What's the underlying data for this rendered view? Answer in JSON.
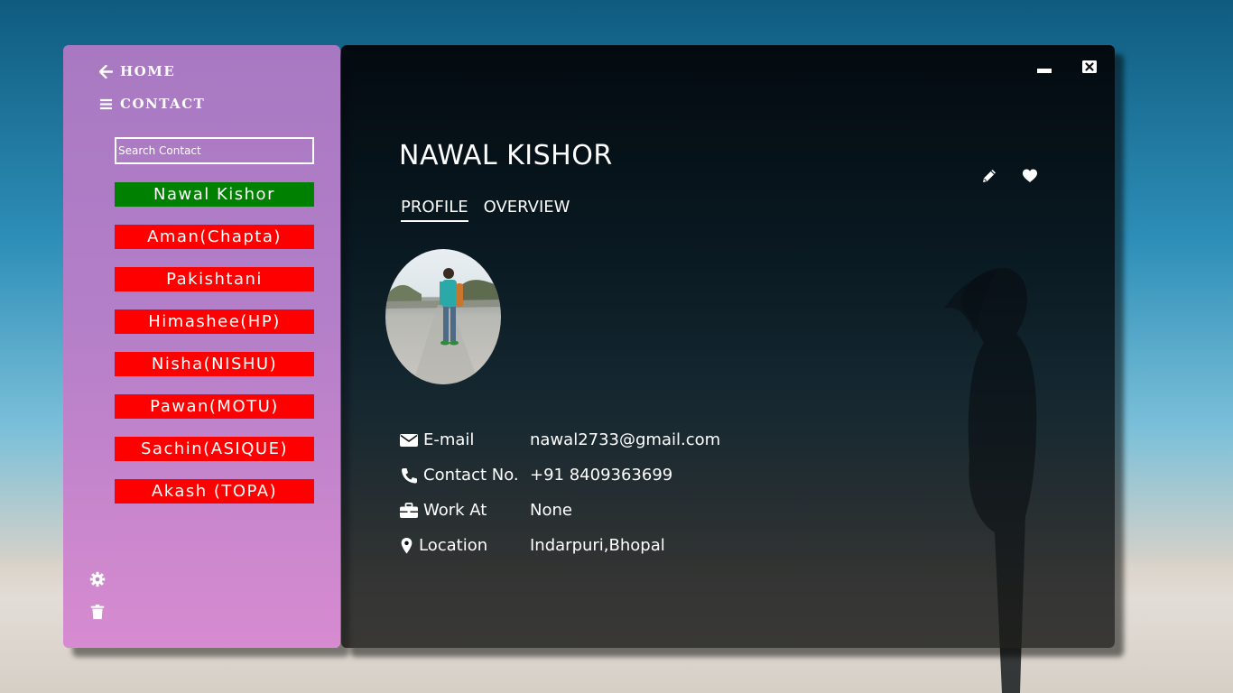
{
  "sidebar": {
    "home_label": "HOME",
    "contact_label": "CONTACT",
    "search_placeholder": "Search Contact",
    "contacts": [
      {
        "name": "Nawal Kishor",
        "color": "#008000"
      },
      {
        "name": "Aman(Chapta)",
        "color": "#ff0000"
      },
      {
        "name": "Pakishtani",
        "color": "#ff0000"
      },
      {
        "name": "Himashee(HP)",
        "color": "#ff0000"
      },
      {
        "name": "Nisha(NISHU)",
        "color": "#ff0000"
      },
      {
        "name": "Pawan(MOTU)",
        "color": "#ff0000"
      },
      {
        "name": "Sachin(ASIQUE)",
        "color": "#ff0000"
      },
      {
        "name": "Akash (TOPA)",
        "color": "#ff0000"
      }
    ],
    "bottom_icons": [
      "gear-icon",
      "trash-icon"
    ]
  },
  "profile": {
    "name": "NAWAL KISHOR",
    "tabs": [
      {
        "label": "PROFILE",
        "active": true
      },
      {
        "label": "OVERVIEW",
        "active": false
      }
    ],
    "action_icons": [
      "pencil-icon",
      "heart-icon"
    ],
    "details": [
      {
        "icon": "envelope-icon",
        "label": "E-mail",
        "value": "nawal2733@gmail.com"
      },
      {
        "icon": "phone-icon",
        "label": "Contact No.",
        "value": "+91 8409363699"
      },
      {
        "icon": "briefcase-icon",
        "label": "Work At",
        "value": "None"
      },
      {
        "icon": "map-marker-icon",
        "label": "Location",
        "value": "Indarpuri,Bhopal"
      }
    ]
  },
  "window_controls": [
    "minimize-icon",
    "close-icon"
  ]
}
